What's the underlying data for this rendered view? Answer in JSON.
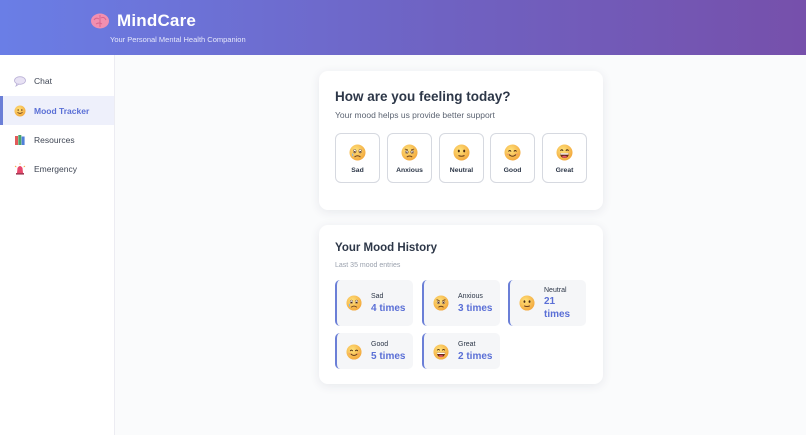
{
  "header": {
    "title": "MindCare",
    "subtitle": "Your Personal Mental Health Companion",
    "brand_icon": "brain-icon",
    "gradient": [
      "#6a7ee6",
      "#7650ab"
    ]
  },
  "sidebar": {
    "accent": "#6b7fd7",
    "items": [
      {
        "label": "Chat",
        "icon": "speech-bubble-icon",
        "active": false
      },
      {
        "label": "Mood Tracker",
        "icon": "smiley-icon",
        "active": true
      },
      {
        "label": "Resources",
        "icon": "books-icon",
        "active": false
      },
      {
        "label": "Emergency",
        "icon": "alarm-light-icon",
        "active": false
      }
    ]
  },
  "mood": {
    "title": "How are you feeling today?",
    "subtitle": "Your mood helps us provide better support",
    "options": [
      {
        "label": "Sad",
        "icon": "sad-face-icon"
      },
      {
        "label": "Anxious",
        "icon": "anxious-face-icon"
      },
      {
        "label": "Neutral",
        "icon": "neutral-face-icon"
      },
      {
        "label": "Good",
        "icon": "smiling-face-icon"
      },
      {
        "label": "Great",
        "icon": "grinning-face-icon"
      }
    ]
  },
  "history": {
    "title": "Your Mood History",
    "subtitle": "Last 35 mood entries",
    "entries": [
      {
        "name": "Sad",
        "count": "4 times",
        "icon": "sad-face-icon"
      },
      {
        "name": "Anxious",
        "count": "3 times",
        "icon": "anxious-face-icon"
      },
      {
        "name": "Neutral",
        "count_line1": "21",
        "count_line2": "times",
        "icon": "neutral-face-icon"
      },
      {
        "name": "Good",
        "count": "5 times",
        "icon": "smiling-face-icon"
      },
      {
        "name": "Great",
        "count": "2 times",
        "icon": "grinning-face-icon"
      }
    ]
  }
}
